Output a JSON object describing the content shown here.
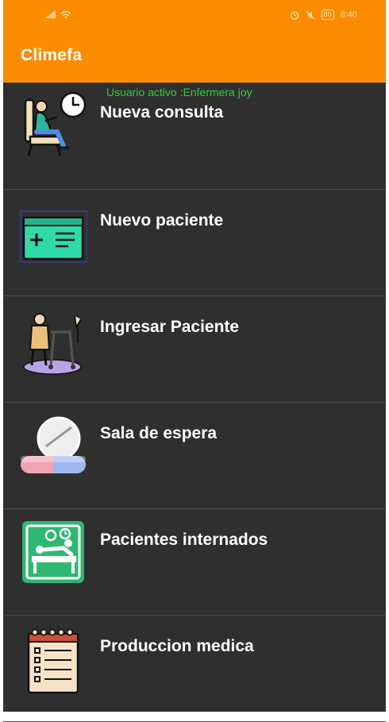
{
  "status": {
    "time": "8:40",
    "battery": "80"
  },
  "app": {
    "title": "Climefa",
    "user_status": "Usuario activo :Enfermera joy"
  },
  "menu": [
    {
      "label": "Nueva consulta",
      "icon": "waiting-patient-icon"
    },
    {
      "label": "Nuevo paciente",
      "icon": "medical-card-icon"
    },
    {
      "label": "Ingresar Paciente",
      "icon": "walker-patient-icon"
    },
    {
      "label": "Sala de espera",
      "icon": "pill-icon"
    },
    {
      "label": "Pacientes internados",
      "icon": "hospital-bed-icon"
    },
    {
      "label": "Produccion medica",
      "icon": "notepad-icon"
    }
  ],
  "colors": {
    "appbar": "#fb8c00",
    "background": "#2f2f2f",
    "user_status": "#2ecc40"
  }
}
